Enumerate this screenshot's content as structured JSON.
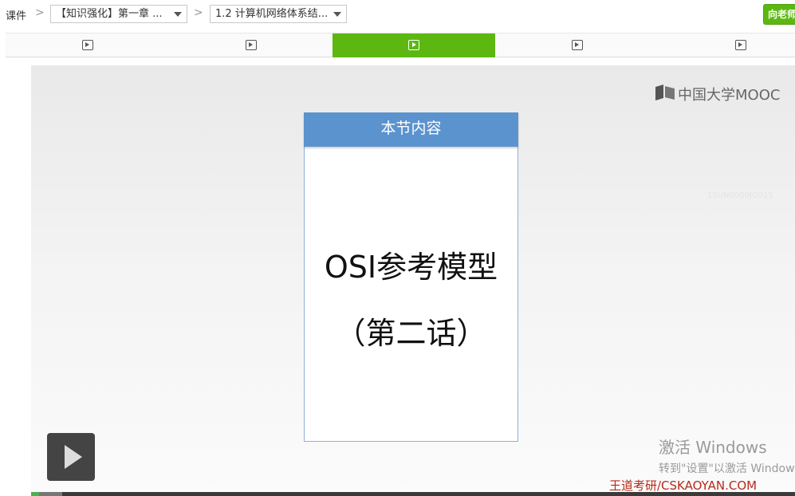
{
  "breadcrumb": {
    "root": "课件",
    "chapter": "【知识强化】第一章 ...",
    "section": "1.2 计算机网络体系结..."
  },
  "header": {
    "ask_teacher": "向老师"
  },
  "tabs": {
    "count": 5,
    "active_index": 2,
    "icon": "video-play-icon"
  },
  "video": {
    "logo": "中国大学MOOC",
    "watermark_id": "1SUN0000JG015",
    "slide": {
      "header": "本节内容",
      "title": "OSI参考模型",
      "subtitle": "（第二话）"
    },
    "progress_fraction": 0.01,
    "buffered_fraction": 0.04
  },
  "overlay": {
    "activate_line1": "激活 Windows",
    "activate_line2": "转到\"设置\"以激活 Windows",
    "brand": "王道考研/CSKAOYAN.COM"
  },
  "colors": {
    "accent_green": "#5cb811",
    "slide_header_blue": "#5b93cf",
    "brand_red": "#b62a1a"
  }
}
